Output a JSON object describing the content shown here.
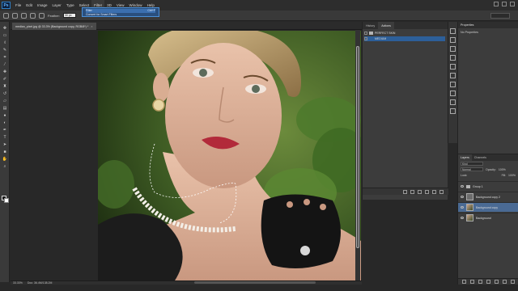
{
  "menubar": {
    "logo": "Ps",
    "items": [
      "File",
      "Edit",
      "Image",
      "Layer",
      "Type",
      "Select",
      "Filter",
      "3D",
      "View",
      "Window",
      "Help"
    ],
    "active_index": 6
  },
  "options": {
    "feather_label": "Feather:",
    "feather_value": "30 px",
    "dropdown_rows": [
      "Filter",
      "Ctrl+F",
      "Convert for Smart Filters"
    ],
    "search_text": ""
  },
  "document": {
    "tab_title": "median_pixel.jpg @ 33.3% (Background copy, RGB/8*) *",
    "zoom": "33.33%",
    "doc_size": "Doc: 36.4M/138.2M"
  },
  "actions_panel": {
    "tabs": [
      "History",
      "Actions"
    ],
    "active_tab": 1,
    "rows": [
      {
        "label": "PERFECT SKIN",
        "selected": false
      },
      {
        "label": "MEDIUM",
        "selected": true
      }
    ]
  },
  "properties_panel": {
    "title": "Properties",
    "subtitle": "No Properties"
  },
  "layers_panel": {
    "tabs": [
      "Layers",
      "Channels"
    ],
    "kind_label": "Kind",
    "blend_mode": "Normal",
    "opacity_label": "Opacity:",
    "opacity_value": "100%",
    "lock_label": "Lock:",
    "fill_label": "Fill:",
    "fill_value": "100%",
    "layers": [
      {
        "name": "Group 1",
        "type": "group",
        "selected": false
      },
      {
        "name": "Background copy 2",
        "type": "layer",
        "selected": false
      },
      {
        "name": "Background copy",
        "type": "photo",
        "selected": true
      },
      {
        "name": "Background",
        "type": "photo",
        "selected": false
      }
    ]
  },
  "colors": {
    "accent_blue": "#2d5f99",
    "ps_logo_bg": "#0c1e3b",
    "panel_bg": "#3c3c3c",
    "selection_layer": "#4a6a94"
  }
}
